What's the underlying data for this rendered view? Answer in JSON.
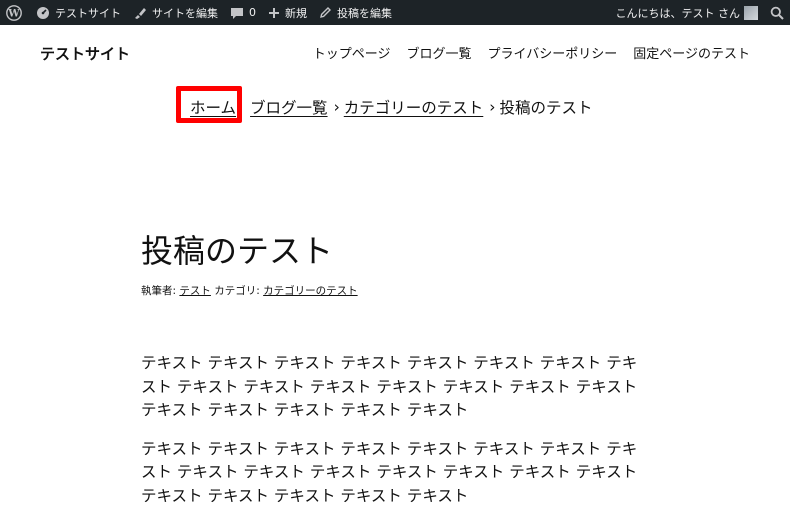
{
  "admin_bar": {
    "site_name": "テストサイト",
    "edit_site": "サイトを編集",
    "comments_count": "0",
    "new_label": "新規",
    "edit_post": "投稿を編集",
    "greeting": "こんにちは、テスト さん"
  },
  "header": {
    "site_title": "テストサイト",
    "nav": [
      "トップページ",
      "ブログ一覧",
      "プライバシーポリシー",
      "固定ページのテスト"
    ]
  },
  "breadcrumb": {
    "home": "ホーム",
    "blog": "ブログ一覧",
    "category": "カテゴリーのテスト",
    "current": "投稿のテスト",
    "separator": "›"
  },
  "post": {
    "title": "投稿のテスト",
    "meta": {
      "author_label": "執筆者:",
      "author": "テスト",
      "category_label": "カテゴリ:",
      "category": "カテゴリーのテスト"
    },
    "paragraphs": [
      "テキスト テキスト テキスト テキスト テキスト テキスト テキスト テキスト テキスト テキスト テキスト テキスト テキスト テキスト テキスト テキスト テキスト テキスト テキスト テキスト",
      "テキスト テキスト テキスト テキスト テキスト テキスト テキスト テキスト テキスト テキスト テキスト テキスト テキスト テキスト テキスト テキスト テキスト テキスト テキスト テキスト"
    ]
  },
  "colors": {
    "admin_bar_bg": "#1d2327",
    "highlight": "#ff0000"
  }
}
